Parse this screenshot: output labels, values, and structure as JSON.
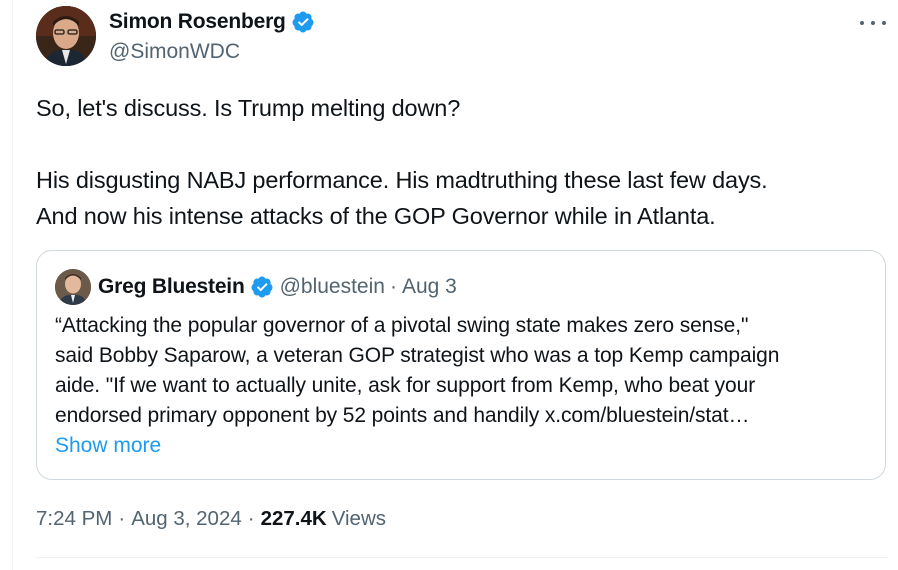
{
  "author": {
    "name": "Simon Rosenberg",
    "handle": "@SimonWDC"
  },
  "tweet": {
    "line1": "So, let's discuss.  Is Trump melting down?",
    "line2": "His disgusting NABJ performance.  His madtruthing these last few days.",
    "line3": "And now his intense attacks of the GOP Governor while in Atlanta."
  },
  "quote": {
    "name": "Greg Bluestein",
    "handle": "@bluestein",
    "separator": "·",
    "date": "Aug 3",
    "lines": [
      "“Attacking the popular governor of a pivotal swing state makes zero sense,\"",
      "said Bobby Saparow, a veteran GOP strategist who was a top Kemp campaign",
      "aide. \"If we want to actually unite, ask for support from Kemp, who beat your",
      "endorsed primary opponent by 52 points and handily x.com/bluestein/stat…"
    ],
    "show_more": "Show more"
  },
  "meta": {
    "time": "7:24 PM",
    "separator": "·",
    "date": "Aug 3, 2024",
    "views_count": "227.4K",
    "views_label": "Views"
  },
  "colors": {
    "text": "#0f1419",
    "secondary": "#536471",
    "link": "#1d9bf0",
    "verified": "#1d9bf0",
    "border": "#cfd9de"
  },
  "icons": {
    "verified": "verified-badge-icon",
    "more": "more-horizontal-icon"
  }
}
